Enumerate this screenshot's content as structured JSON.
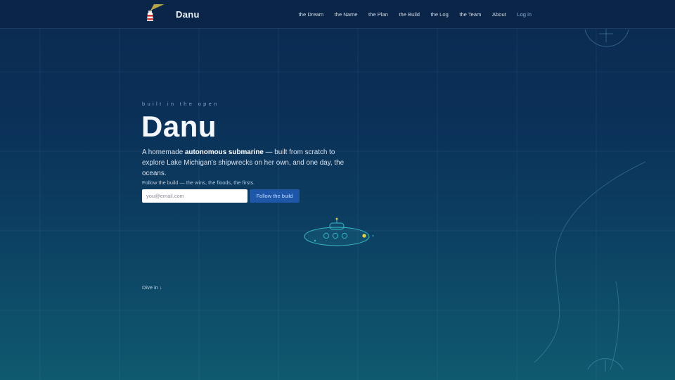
{
  "brand": {
    "name": "Danu",
    "icon": "lighthouse-icon"
  },
  "nav": {
    "items": [
      "the Dream",
      "the Name",
      "the Plan",
      "the Build",
      "the Log",
      "the Team",
      "About"
    ],
    "login": "Log in"
  },
  "hero": {
    "eyebrow": "built in the open",
    "title": "Danu",
    "desc_pre": "A homemade ",
    "desc_bold": "autonomous submarine",
    "desc_post": " — built from scratch to explore Lake Michigan's shipwrecks on her own, and one day, the oceans.",
    "follow_note": "Follow the build — the wins, the floods, the firsts.",
    "email_placeholder": "you@email.com",
    "follow_button": "Follow the build",
    "dive": "Dive in",
    "dive_icon": "arrow-down-icon"
  },
  "colors": {
    "bg_top": "#0b2a50",
    "bg_bottom": "#0f5a6e",
    "accent_button": "#1e56a8",
    "sub_outline": "#38b8c4",
    "beacon": "#e3d440"
  }
}
